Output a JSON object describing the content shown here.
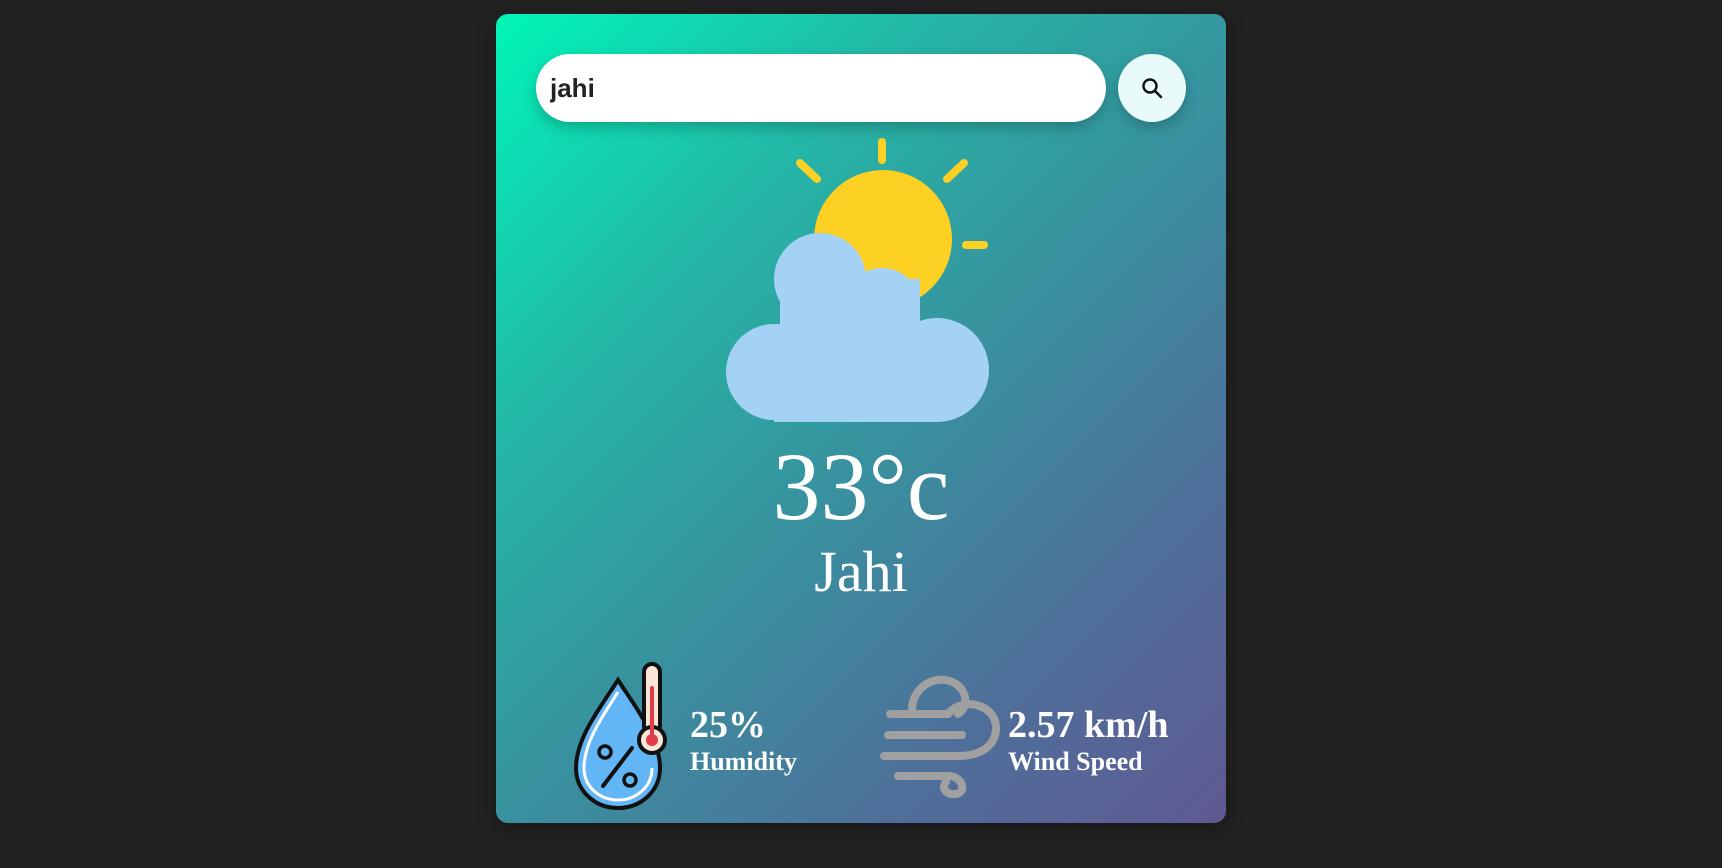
{
  "search": {
    "value": "jahi",
    "placeholder": ""
  },
  "search_button": {
    "icon": "search-icon"
  },
  "weather": {
    "condition_icon": "partly-cloudy-icon",
    "temperature": "33°c",
    "city": "Jahi"
  },
  "details": {
    "humidity": {
      "icon": "humidity-icon",
      "value": "25%",
      "label": "Humidity"
    },
    "wind": {
      "icon": "wind-icon",
      "value": "2.57 km/h",
      "label": "Wind Speed"
    }
  },
  "colors": {
    "background": "#222222",
    "gradient_start": "#00f5b8",
    "gradient_end": "#5f5992",
    "sun": "#fdd024",
    "cloud": "#a4d2f5",
    "text": "#ffffff"
  }
}
